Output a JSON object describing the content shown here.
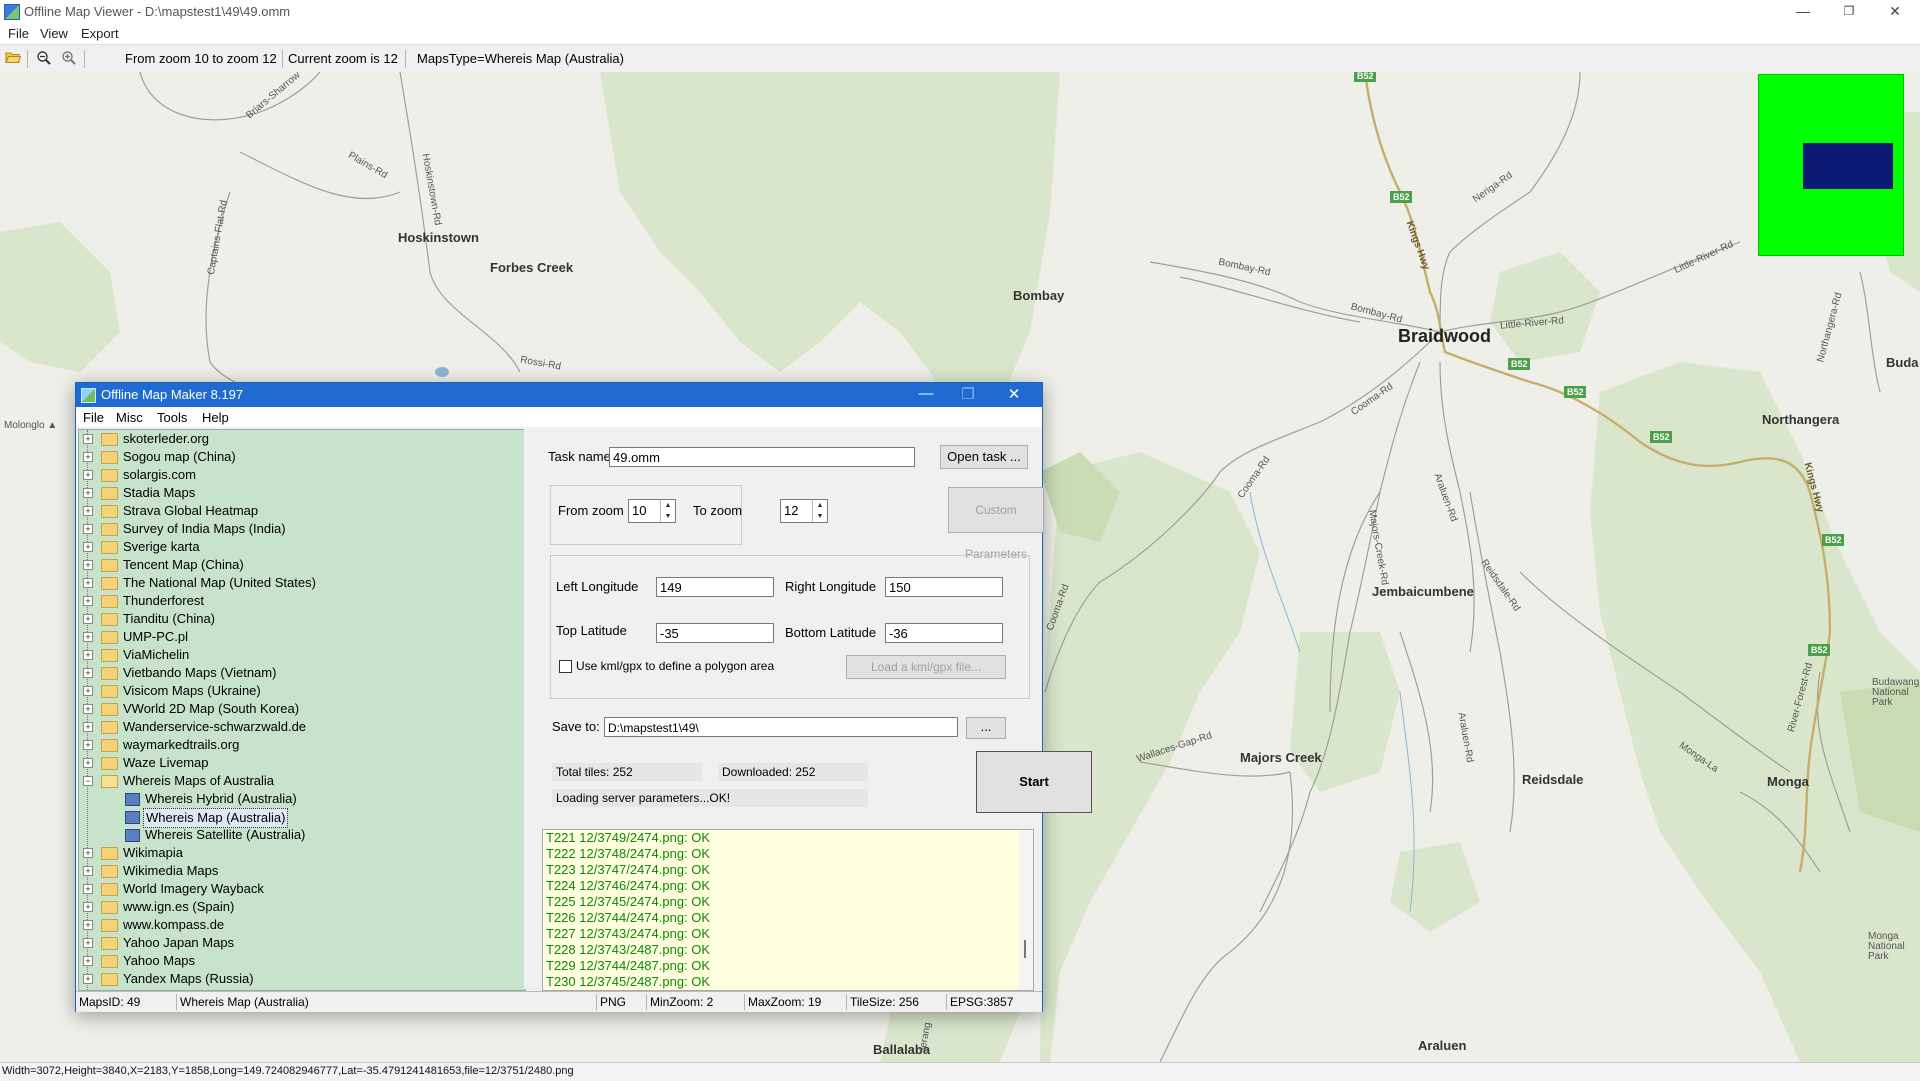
{
  "window": {
    "title": "Offline Map Viewer - D:\\mapstest1\\49\\49.omm",
    "minimize_glyph": "—",
    "maximize_glyph": "❐",
    "close_glyph": "✕"
  },
  "menu": {
    "file": "File",
    "view": "View",
    "export": "Export"
  },
  "toolbar": {
    "open_icon": "folder-open-icon",
    "zoom_out_icon": "zoom-out-icon",
    "zoom_in_icon": "zoom-in-icon",
    "zoom_range": "From zoom 10 to zoom 12",
    "current_zoom": "Current zoom is 12",
    "maps_type": "MapsType=Whereis Map (Australia)"
  },
  "map": {
    "places": {
      "hoskinstown": "Hoskinstown",
      "forbes_creek": "Forbes Creek",
      "bombay": "Bombay",
      "braidwood": "Braidwood",
      "northangera": "Northangera",
      "buda": "Buda",
      "jembaicumbene": "Jembaicumbene",
      "majors_creek": "Majors Creek",
      "reidsdale": "Reidsdale",
      "monga": "Monga",
      "ballalaba": "Ballalaba",
      "araluen": "Araluen",
      "molonglo": "Molonglo ▲"
    },
    "roads": {
      "plains_rd": "Plains-Rd",
      "hoskinstown_rd": "Hoskinstown-Rd",
      "briars_sharrow_rd": "Briars-Sharrow",
      "captains_flat_rd": "Captains-Flat-Rd",
      "rossi_rd": "Rossi-Rd",
      "bombay_rd_1": "Bombay-Rd",
      "bombay_rd_2": "Bombay-Rd",
      "little_river_rd_1": "Little-River-Rd",
      "little_river_rd_2": "Little-River-Rd",
      "neriga_rd": "Neriga-Rd",
      "kings_hwy_1": "Kings Hwy",
      "kings_hwy_2": "Kings Hwy",
      "cooma_rd_1": "Cooma-Rd",
      "cooma_rd_2": "Cooma-Rd",
      "cooma_rd_3": "Cooma-Rd",
      "majors_creek_rd": "Majors-Creek-Rd",
      "araluen_rd_1": "Araluen-Rd",
      "araluen_rd_2": "Araluen-Rd",
      "reidsdale_rd": "Reidsdale-Rd",
      "wallaces_gap_rd": "Wallaces-Gap-Rd",
      "monga_la": "Monga-La",
      "northangera_rd": "Northangera-Rd",
      "river_forest_rd": "River-Forest-Rd",
      "jerang": "Jerang"
    },
    "parks": {
      "budawang": "Budawang National Park",
      "monga": "Monga National Park"
    },
    "highway_shield": "B52",
    "colors": {
      "land": "#efefe9",
      "forest": "#d9e6cb",
      "minimap_bg": "#00ff00",
      "minimap_view": "#0b1a74"
    }
  },
  "statusbar": {
    "text": "Width=3072,Height=3840,X=2183,Y=1858,Long=149.724082946777,Lat=-35.4791241481653,file=12/3751/2480.png"
  },
  "dialog": {
    "title": "Offline Map Maker 8.197",
    "menu": {
      "file": "File",
      "misc": "Misc",
      "tools": "Tools",
      "help": "Help"
    },
    "tree": {
      "items": [
        {
          "label": "skoterleder.org",
          "exp": "+"
        },
        {
          "label": "Sogou map (China)",
          "exp": "+"
        },
        {
          "label": "solargis.com",
          "exp": "+"
        },
        {
          "label": "Stadia Maps",
          "exp": "+"
        },
        {
          "label": "Strava Global Heatmap",
          "exp": "+"
        },
        {
          "label": "Survey of India Maps (India)",
          "exp": "+"
        },
        {
          "label": "Sverige karta",
          "exp": "+"
        },
        {
          "label": "Tencent Map (China)",
          "exp": "+"
        },
        {
          "label": "The National Map (United States)",
          "exp": "+"
        },
        {
          "label": "Thunderforest",
          "exp": "+"
        },
        {
          "label": "Tianditu (China)",
          "exp": "+"
        },
        {
          "label": "UMP-PC.pl",
          "exp": "+"
        },
        {
          "label": "ViaMichelin",
          "exp": "+"
        },
        {
          "label": "Vietbando Maps (Vietnam)",
          "exp": "+"
        },
        {
          "label": "Visicom Maps (Ukraine)",
          "exp": "+"
        },
        {
          "label": "VWorld 2D Map (South Korea)",
          "exp": "+"
        },
        {
          "label": "Wanderservice-schwarzwald.de",
          "exp": "+"
        },
        {
          "label": "waymarkedtrails.org",
          "exp": "+"
        },
        {
          "label": "Waze Livemap",
          "exp": "+"
        },
        {
          "label": "Whereis Maps of Australia",
          "exp": "−"
        },
        {
          "label": "Whereis Hybrid (Australia)",
          "child": true
        },
        {
          "label": "Whereis Map (Australia)",
          "child": true,
          "selected": true
        },
        {
          "label": "Whereis Satellite (Australia)",
          "child": true
        },
        {
          "label": "Wikimapia",
          "exp": "+"
        },
        {
          "label": "Wikimedia Maps",
          "exp": "+"
        },
        {
          "label": "World Imagery Wayback",
          "exp": "+"
        },
        {
          "label": "www.ign.es (Spain)",
          "exp": "+"
        },
        {
          "label": "www.kompass.de",
          "exp": "+"
        },
        {
          "label": "Yahoo Japan Maps",
          "exp": "+"
        },
        {
          "label": "Yahoo Maps",
          "exp": "+"
        },
        {
          "label": "Yandex Maps (Russia)",
          "exp": "+"
        }
      ]
    },
    "task": {
      "label": "Task name",
      "value": "49.omm",
      "open_button": "Open task ..."
    },
    "zoom": {
      "from_label": "From zoom",
      "from_value": "10",
      "to_label": "To zoom",
      "to_value": "12",
      "custom_button": "Custom Parameters",
      "spin_up": "▲",
      "spin_down": "▼"
    },
    "bounds": {
      "left_lon_label": "Left Longitude",
      "left_lon": "149",
      "right_lon_label": "Right Longitude",
      "right_lon": "150",
      "top_lat_label": "Top Latitude",
      "top_lat": "-35",
      "bottom_lat_label": "Bottom Latitude",
      "bottom_lat": "-36",
      "kml_checkbox_label": "Use kml/gpx to define a polygon area",
      "kml_checked": false,
      "load_kml_button": "Load a kml/gpx file..."
    },
    "save": {
      "label": "Save to:",
      "value": "D:\\mapstest1\\49\\",
      "browse_button": "..."
    },
    "progress": {
      "total_tiles": "Total tiles: 252",
      "downloaded": "Downloaded: 252",
      "server_status": "Loading server parameters...OK!",
      "start_button": "Start"
    },
    "log": [
      "T221 12/3749/2474.png: OK",
      "T222 12/3748/2474.png: OK",
      "T223 12/3747/2474.png: OK",
      "T224 12/3746/2474.png: OK",
      "T225 12/3745/2474.png: OK",
      "T226 12/3744/2474.png: OK",
      "T227 12/3743/2474.png: OK",
      "T228 12/3743/2487.png: OK",
      "T229 12/3744/2487.png: OK",
      "T230 12/3745/2487.png: OK"
    ],
    "status": {
      "maps_id": "MapsID: 49",
      "map_name": "Whereis Map (Australia)",
      "format": "PNG",
      "min_zoom": "MinZoom: 2",
      "max_zoom": "MaxZoom: 19",
      "tile_size": "TileSize: 256",
      "epsg": "EPSG:3857"
    }
  }
}
